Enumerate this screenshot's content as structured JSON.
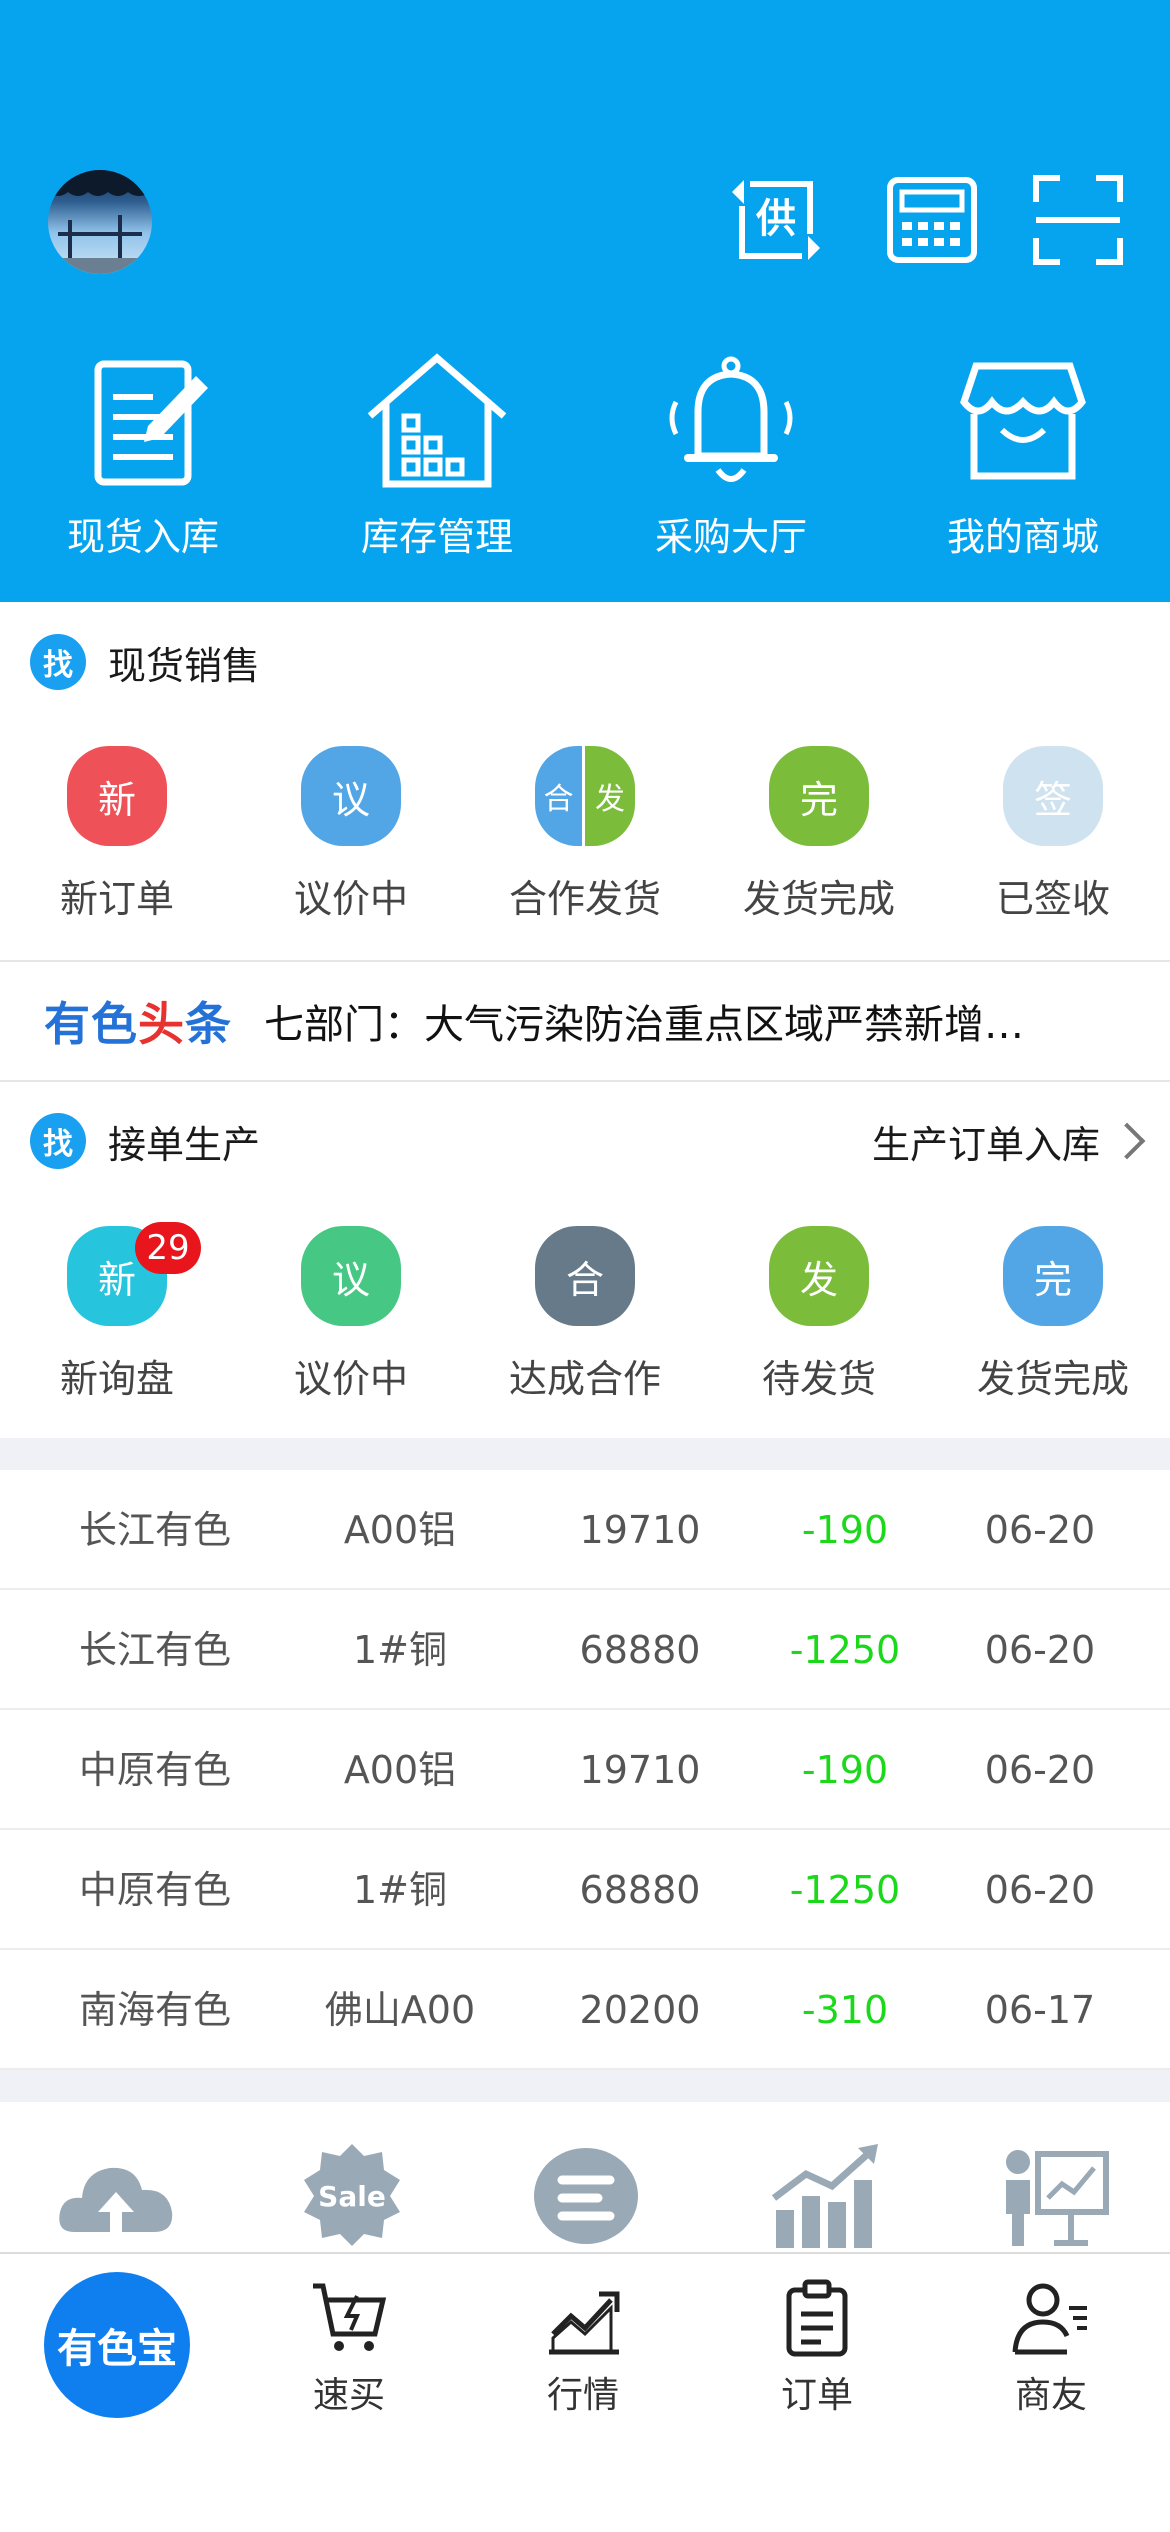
{
  "colors": {
    "header_bg": "#06a4ef",
    "price_down": "#1bd81b",
    "badge_red": "#e8161c",
    "home_blue": "#0f7ff0"
  },
  "header": {
    "top_icons": [
      "supply-exchange-icon",
      "calculator-icon",
      "scan-icon"
    ],
    "quick_actions": [
      {
        "label": "现货入库",
        "icon": "document-edit-icon"
      },
      {
        "label": "库存管理",
        "icon": "warehouse-icon"
      },
      {
        "label": "采购大厅",
        "icon": "bell-icon"
      },
      {
        "label": "我的商城",
        "icon": "shop-icon"
      }
    ],
    "supply_glyph": "供"
  },
  "spot_sales": {
    "badge": "找",
    "title": "现货销售",
    "items": [
      {
        "glyph": "新",
        "label": "新订单",
        "color": "#ee5157"
      },
      {
        "glyph": "议",
        "label": "议价中",
        "color": "#53a6e6"
      },
      {
        "glyph_left": "合",
        "glyph_right": "发",
        "label": "合作发货",
        "color_left": "#53a6e6",
        "color_right": "#7bbd3a"
      },
      {
        "glyph": "完",
        "label": "发货完成",
        "color": "#7bbd3a"
      },
      {
        "glyph": "签",
        "label": "已签收",
        "color": "#cfe2ef"
      }
    ]
  },
  "news": {
    "logo_1": "有色",
    "logo_2": "头",
    "logo_3": "条",
    "headline": "七部门：大气污染防治重点区域严禁新增…"
  },
  "production": {
    "badge": "找",
    "title": "接单生产",
    "link_label": "生产订单入库",
    "items": [
      {
        "glyph": "新",
        "label": "新询盘",
        "color": "#26c4dd",
        "count": "29"
      },
      {
        "glyph": "议",
        "label": "议价中",
        "color": "#46c884"
      },
      {
        "glyph": "合",
        "label": "达成合作",
        "color": "#667a89"
      },
      {
        "glyph": "发",
        "label": "待发货",
        "color": "#7bbd3a"
      },
      {
        "glyph": "完",
        "label": "发货完成",
        "color": "#53a6e6"
      }
    ]
  },
  "prices": {
    "rows": [
      {
        "market": "长江有色",
        "product": "A00铝",
        "price": "19710",
        "change": "-190",
        "date": "06-20"
      },
      {
        "market": "长江有色",
        "product": "1#铜",
        "price": "68880",
        "change": "-1250",
        "date": "06-20"
      },
      {
        "market": "中原有色",
        "product": "A00铝",
        "price": "19710",
        "change": "-190",
        "date": "06-20"
      },
      {
        "market": "中原有色",
        "product": "1#铜",
        "price": "68880",
        "change": "-1250",
        "date": "06-20"
      },
      {
        "market": "南海有色",
        "product": "佛山A00",
        "price": "20200",
        "change": "-310",
        "date": "06-17"
      }
    ]
  },
  "features": {
    "sale_label": "Sale",
    "icons": [
      "cloud-upload-icon",
      "sale-badge-icon",
      "e-logo-icon",
      "growth-chart-icon",
      "presentation-icon"
    ]
  },
  "tabbar": {
    "home_label": "有色宝",
    "tabs": [
      {
        "label": "速买",
        "icon": "quick-buy-cart-icon"
      },
      {
        "label": "行情",
        "icon": "market-trend-icon"
      },
      {
        "label": "订单",
        "icon": "order-clipboard-icon"
      },
      {
        "label": "商友",
        "icon": "contacts-icon"
      }
    ]
  }
}
